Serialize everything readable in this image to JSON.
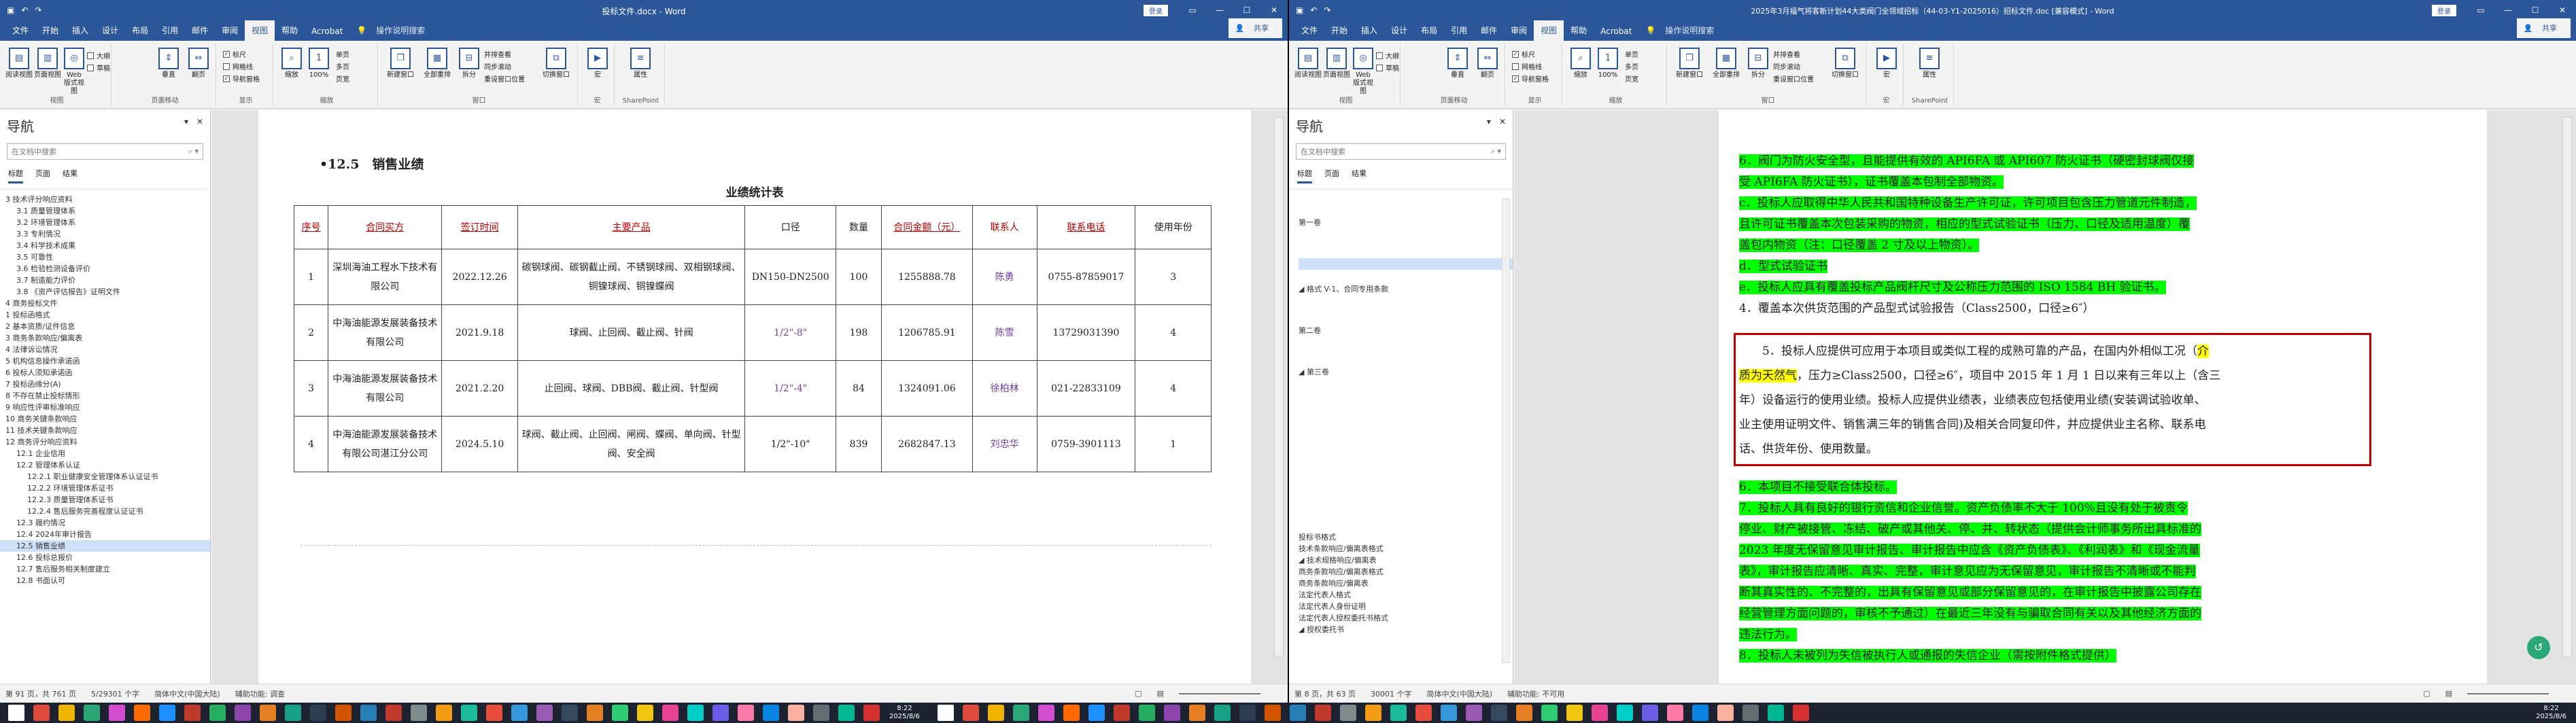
{
  "left": {
    "title": "投标文件.docx - Word",
    "login": "登录",
    "share": "共享",
    "tabs": [
      "文件",
      "开始",
      "插入",
      "设计",
      "布局",
      "引用",
      "邮件",
      "审阅",
      "视图",
      "帮助",
      "Acrobat"
    ],
    "tell": "操作说明搜索",
    "ribbon": {
      "groups": [
        "视图",
        "页面移动",
        "显示",
        "缩放",
        "窗口",
        "宏",
        "SharePoint"
      ],
      "read": "阅读视图",
      "print": "页面视图",
      "web": "Web 版式视图",
      "outline": "大纲",
      "draft": "草稿",
      "vertical": "垂直",
      "side": "翻页",
      "ruler": "标尺",
      "grid": "网格线",
      "navpane": "导航窗格",
      "zoom": "缩放",
      "zoom100": "100%",
      "onepage": "单页",
      "multipage": "多页",
      "pagewidth": "页宽",
      "newwin": "新建窗口",
      "arrange": "全部重排",
      "split": "拆分",
      "sidebyside": "并排查看",
      "sync": "同步滚动",
      "reset": "重设窗口位置",
      "switch": "切换窗口",
      "macro": "宏",
      "prop": "属性"
    },
    "nav": {
      "title": "导航",
      "search": "在文档中搜索",
      "tabs": [
        "标题",
        "页面",
        "结果"
      ],
      "items": [
        "3 技术评分响应资料",
        "3.1 质量管理体系",
        "3.2 环境管理体系",
        "3.3 专利情况",
        "3.4 科学技术成果",
        "3.5 可靠性",
        "3.6 检验检测设备评价",
        "3.7 制造能力评价",
        "3.8 《资产评估报告》证明文件",
        "4 商务投标文件",
        "1 投标函格式",
        "2 基本资质/证件信息",
        "3 商务条款响应/偏离表",
        "4 法律诉讼情况",
        "5 机构信息操作承诺函",
        "6 投标人须知承诺函",
        "7 投标函缘分(A)",
        "8 不存在禁止投标情形",
        "9 响应性评审标准响应",
        "10 商务关键条款响应",
        "11 技术关键条款响应",
        "12 商务评分响应资料",
        "12.1 企业信用",
        "12.2 管理体系认证",
        "12.2.1 职业健康安全管理体系认证证书",
        "12.2.2 环境管理体系证书",
        "12.2.3 质量管理体系证书",
        "12.2.4 售后服务完善程度认证证书",
        "12.3 履约情况",
        "12.4 2024年审计报告",
        "12.5 销售业绩",
        "12.6 投标总报价",
        "12.7 售后服务相关制度建立",
        "12.8 书面认可"
      ]
    },
    "heading": "•12.5　销售业绩",
    "table_caption": "业绩统计表",
    "table": {
      "headers": [
        "序号",
        "合同买方",
        "签订时间",
        "主要产品",
        "口径",
        "数量",
        "合同金额（元）",
        "联系人",
        "联系电话",
        "使用年份"
      ],
      "rows": [
        [
          "1",
          "深圳海油工程水下技术有限公司",
          "2022.12.26",
          "碳钢球阀、碳钢截止阀、不锈钢球阀、双相钢球阀、铜镍球阀、铜镍蝶阀",
          "DN150-DN2500",
          "100",
          "1255888.78",
          "陈勇",
          "0755-87859017",
          "3"
        ],
        [
          "2",
          "中海油能源发展装备技术有限公司",
          "2021.9.18",
          "球阀、止回阀、截止阀、针阀",
          "1/2\"-8\"",
          "198",
          "1206785.91",
          "陈雪",
          "13729031390",
          "4"
        ],
        [
          "3",
          "中海油能源发展装备技术有限公司",
          "2021.2.20",
          "止回阀、球阀、DBB阀、截止阀、针型阀",
          "1/2\"-4\"",
          "84",
          "1324091.06",
          "徐柏林",
          "021-22833109",
          "4"
        ],
        [
          "4",
          "中海油能源发展装备技术有限公司湛江分公司",
          "2024.5.10",
          "球阀、截止阀、止回阀、闸阀、蝶阀、单向阀、针型阀、安全阀",
          "1/2\"-10\"",
          "839",
          "2682847.13",
          "刘忠华",
          "0759-3901113",
          "1"
        ]
      ]
    },
    "status": {
      "page": "第 91 页，共 761 页",
      "words": "5/29301 个字",
      "lang": "简体中文(中国大陆)",
      "mode": "辅助功能: 调查"
    }
  },
  "right": {
    "title": "2025年3月福气将客新计划44大类阀门全领域招标（44-03-Y1-2025016）招标文件.doc [兼容模式] - Word",
    "login": "登录",
    "share": "共享",
    "tabs": [
      "文件",
      "开始",
      "插入",
      "设计",
      "布局",
      "引用",
      "邮件",
      "审阅",
      "视图",
      "帮助",
      "Acrobat"
    ],
    "tell": "操作说明搜索",
    "nav": {
      "title": "导航",
      "search": "在文档中搜索",
      "tabs": [
        "标题",
        "页面",
        "结果"
      ],
      "top": [
        {
          "t": "第一卷",
          "sel": false
        },
        {
          "t": "",
          "sel": true
        },
        {
          "t": "◢ 格式 V-1、合同专用条款",
          "sel": false
        },
        {
          "t": "第二卷",
          "sel": false
        },
        {
          "t": "◢ 第三卷",
          "sel": false
        }
      ],
      "bottom": [
        "投标书格式",
        "技术条款响应/偏离表格式",
        "◢ 技术规格响应/偏离表",
        "商务条款响应/偏离表格式",
        "商务条款响应/偏离表",
        "法定代表人格式",
        "法定代表人身份证明",
        "法定代表人授权委托书格式",
        "◢ 授权委托书"
      ]
    },
    "lines": [
      {
        "t": "6．阀门为防火安全型，且能提供有效的 API6FA 或 API607 防火证书（硬密封球阀仅接",
        "hl": "g"
      },
      {
        "t": "受 API6FA 防火证书），证书覆盖本包制全部物资。",
        "hl": "g"
      },
      {
        "t": "c．投标人应取得中华人民共和国特种设备生产许可证，许可项目包含压力管道元件制造，",
        "hl": "g"
      },
      {
        "t": "且许可证书覆盖本次包装采购的物资，相应的型式试验证书（压力、口径及适用温度）覆",
        "hl": "g"
      },
      {
        "t": "盖包内物资（注：口径覆盖 2 寸及以上物资）。",
        "hl": "g"
      },
      {
        "t": "d．型式试验证书",
        "hl": "g"
      },
      {
        "t": "e．投标人应具有覆盖投标产品阀杆尺寸及公称压力范围的 ISO 1584 BH 验证书。",
        "hl": "g"
      },
      {
        "t": "4．覆盖本次供货范围的产品型式试验报告（Class2500，口径≥6″）",
        "hl": "n"
      }
    ],
    "box": [
      "　　5．投标人应提供可应用于本项目或类似工程的成熟可靠的产品，在国内外相似工况（介",
      "质为天然气，压力≥Class2500，口径≥6″，项目中 2015 年 1 月 1 日以来有三年以上（含三",
      "年）设备运行的使用业绩。投标人应提供业绩表，业绩表应包括使用业绩(安装调试验收单、",
      "业主使用证明文件、销售满三年的销售合同)及相关合同复印件，并应提供业主名称、联系电",
      "话、供货年份、使用数量。"
    ],
    "lines2": [
      {
        "t": "6．本项目不接受联合体投标。",
        "hl": "g"
      },
      {
        "t": "7．投标人具有良好的银行资信和企业信誉。资产负债率不大于 100%且没有处于被责令",
        "hl": "g"
      },
      {
        "t": "停业、财产被接管、冻结、破产或其他关、停、并、转状态（提供会计师事务所出具标准的",
        "hl": "g"
      },
      {
        "t": "2023 年度无保留意见审计报告、审计报告中应含《资产负债表》、《利润表》和《现金流量",
        "hl": "g"
      },
      {
        "t": "表》，审计报告应清晰、真实、完整，审计意见应为无保留意见，审计报告不清晰或不能判",
        "hl": "g"
      },
      {
        "t": "断其真实性的、不完整的，出具有保留意见或部分保留意见的，在审计报告中披露公司存在",
        "hl": "g"
      },
      {
        "t": "经营管理方面问题的，审核不予通过）在最近三年没有与骗取合同有关以及其他经济方面的",
        "hl": "g"
      },
      {
        "t": "违法行为。",
        "hl": "g"
      },
      {
        "t": "8．投标人未被列为失信被执行人或通报的失信企业（需按附件格式提供）",
        "hl": "g"
      }
    ],
    "status": {
      "page": "第 8 页，共 63 页",
      "words": "30001 个字",
      "lang": "简体中文(中国大陆)",
      "mode": "辅助功能: 不可用"
    }
  },
  "taskbar": {
    "time": "8:22",
    "date": "2025/8/6"
  },
  "colors": {
    "word_blue": "#2b579a",
    "highlight_green": "#00ff00",
    "highlight_yellow": "#ffff00",
    "box_red": "#c00000"
  }
}
